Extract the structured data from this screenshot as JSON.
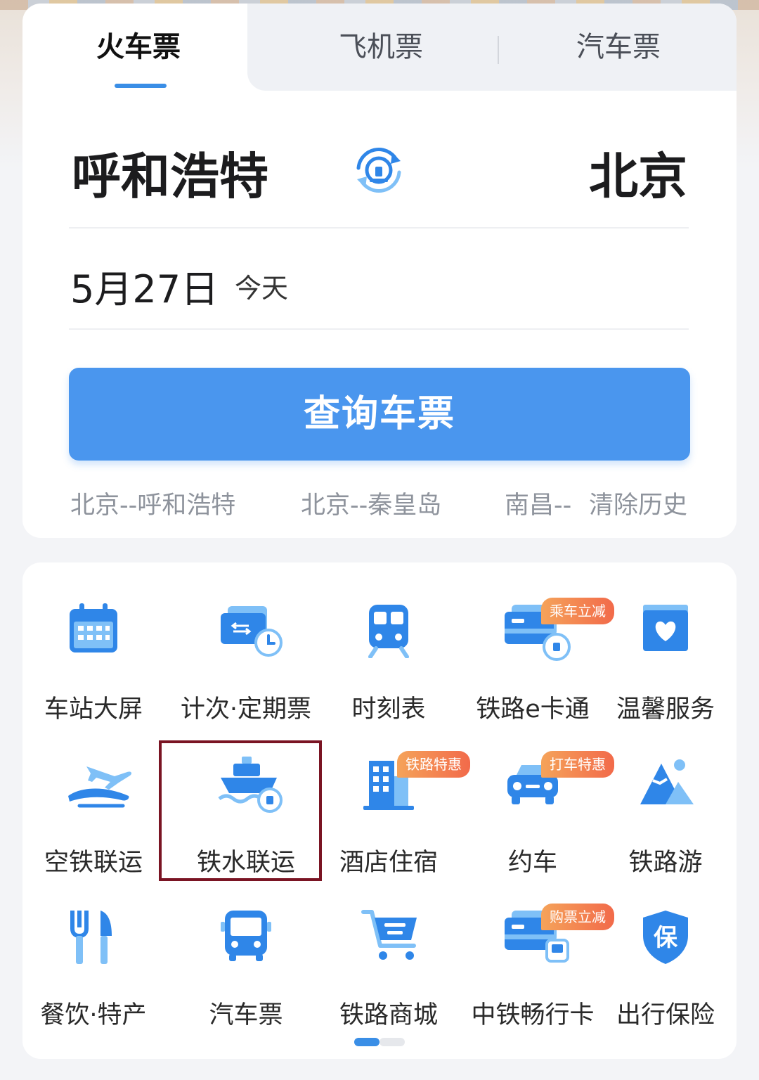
{
  "tabs": [
    "火车票",
    "飞机票",
    "汽车票"
  ],
  "route": {
    "from": "呼和浩特",
    "to": "北京"
  },
  "date": {
    "value": "5月27日",
    "relative": "今天"
  },
  "query_button": "查询车票",
  "history": {
    "items": [
      "北京--呼和浩特",
      "北京--秦皇岛",
      "南昌--"
    ],
    "clear": "清除历史"
  },
  "services": [
    {
      "label": "车站大屏",
      "icon": "calendar-icon"
    },
    {
      "label": "计次·定期票",
      "icon": "ticket-clock-icon"
    },
    {
      "label": "时刻表",
      "icon": "train-icon"
    },
    {
      "label": "铁路e卡通",
      "icon": "card-icon",
      "badge": "乘车立减"
    },
    {
      "label": "温馨服务",
      "icon": "heart-box-icon"
    },
    {
      "label": "空铁联运",
      "icon": "plane-train-icon"
    },
    {
      "label": "铁水联运",
      "icon": "ship-icon"
    },
    {
      "label": "酒店住宿",
      "icon": "hotel-icon",
      "badge": "铁路特惠"
    },
    {
      "label": "约车",
      "icon": "car-icon",
      "badge": "打车特惠"
    },
    {
      "label": "铁路游",
      "icon": "mountain-icon"
    },
    {
      "label": "餐饮·特产",
      "icon": "fork-knife-icon"
    },
    {
      "label": "汽车票",
      "icon": "bus-icon"
    },
    {
      "label": "铁路商城",
      "icon": "cart-icon"
    },
    {
      "label": "中铁畅行卡",
      "icon": "card-train-icon",
      "badge": "购票立减"
    },
    {
      "label": "出行保险",
      "icon": "shield-icon"
    }
  ],
  "colors": {
    "accent": "#4a96ee",
    "icon_blue": "#2f86e8",
    "icon_light": "#7fc0f7",
    "badge_orange": "#f26a4a",
    "highlight_border": "#7a1423"
  }
}
